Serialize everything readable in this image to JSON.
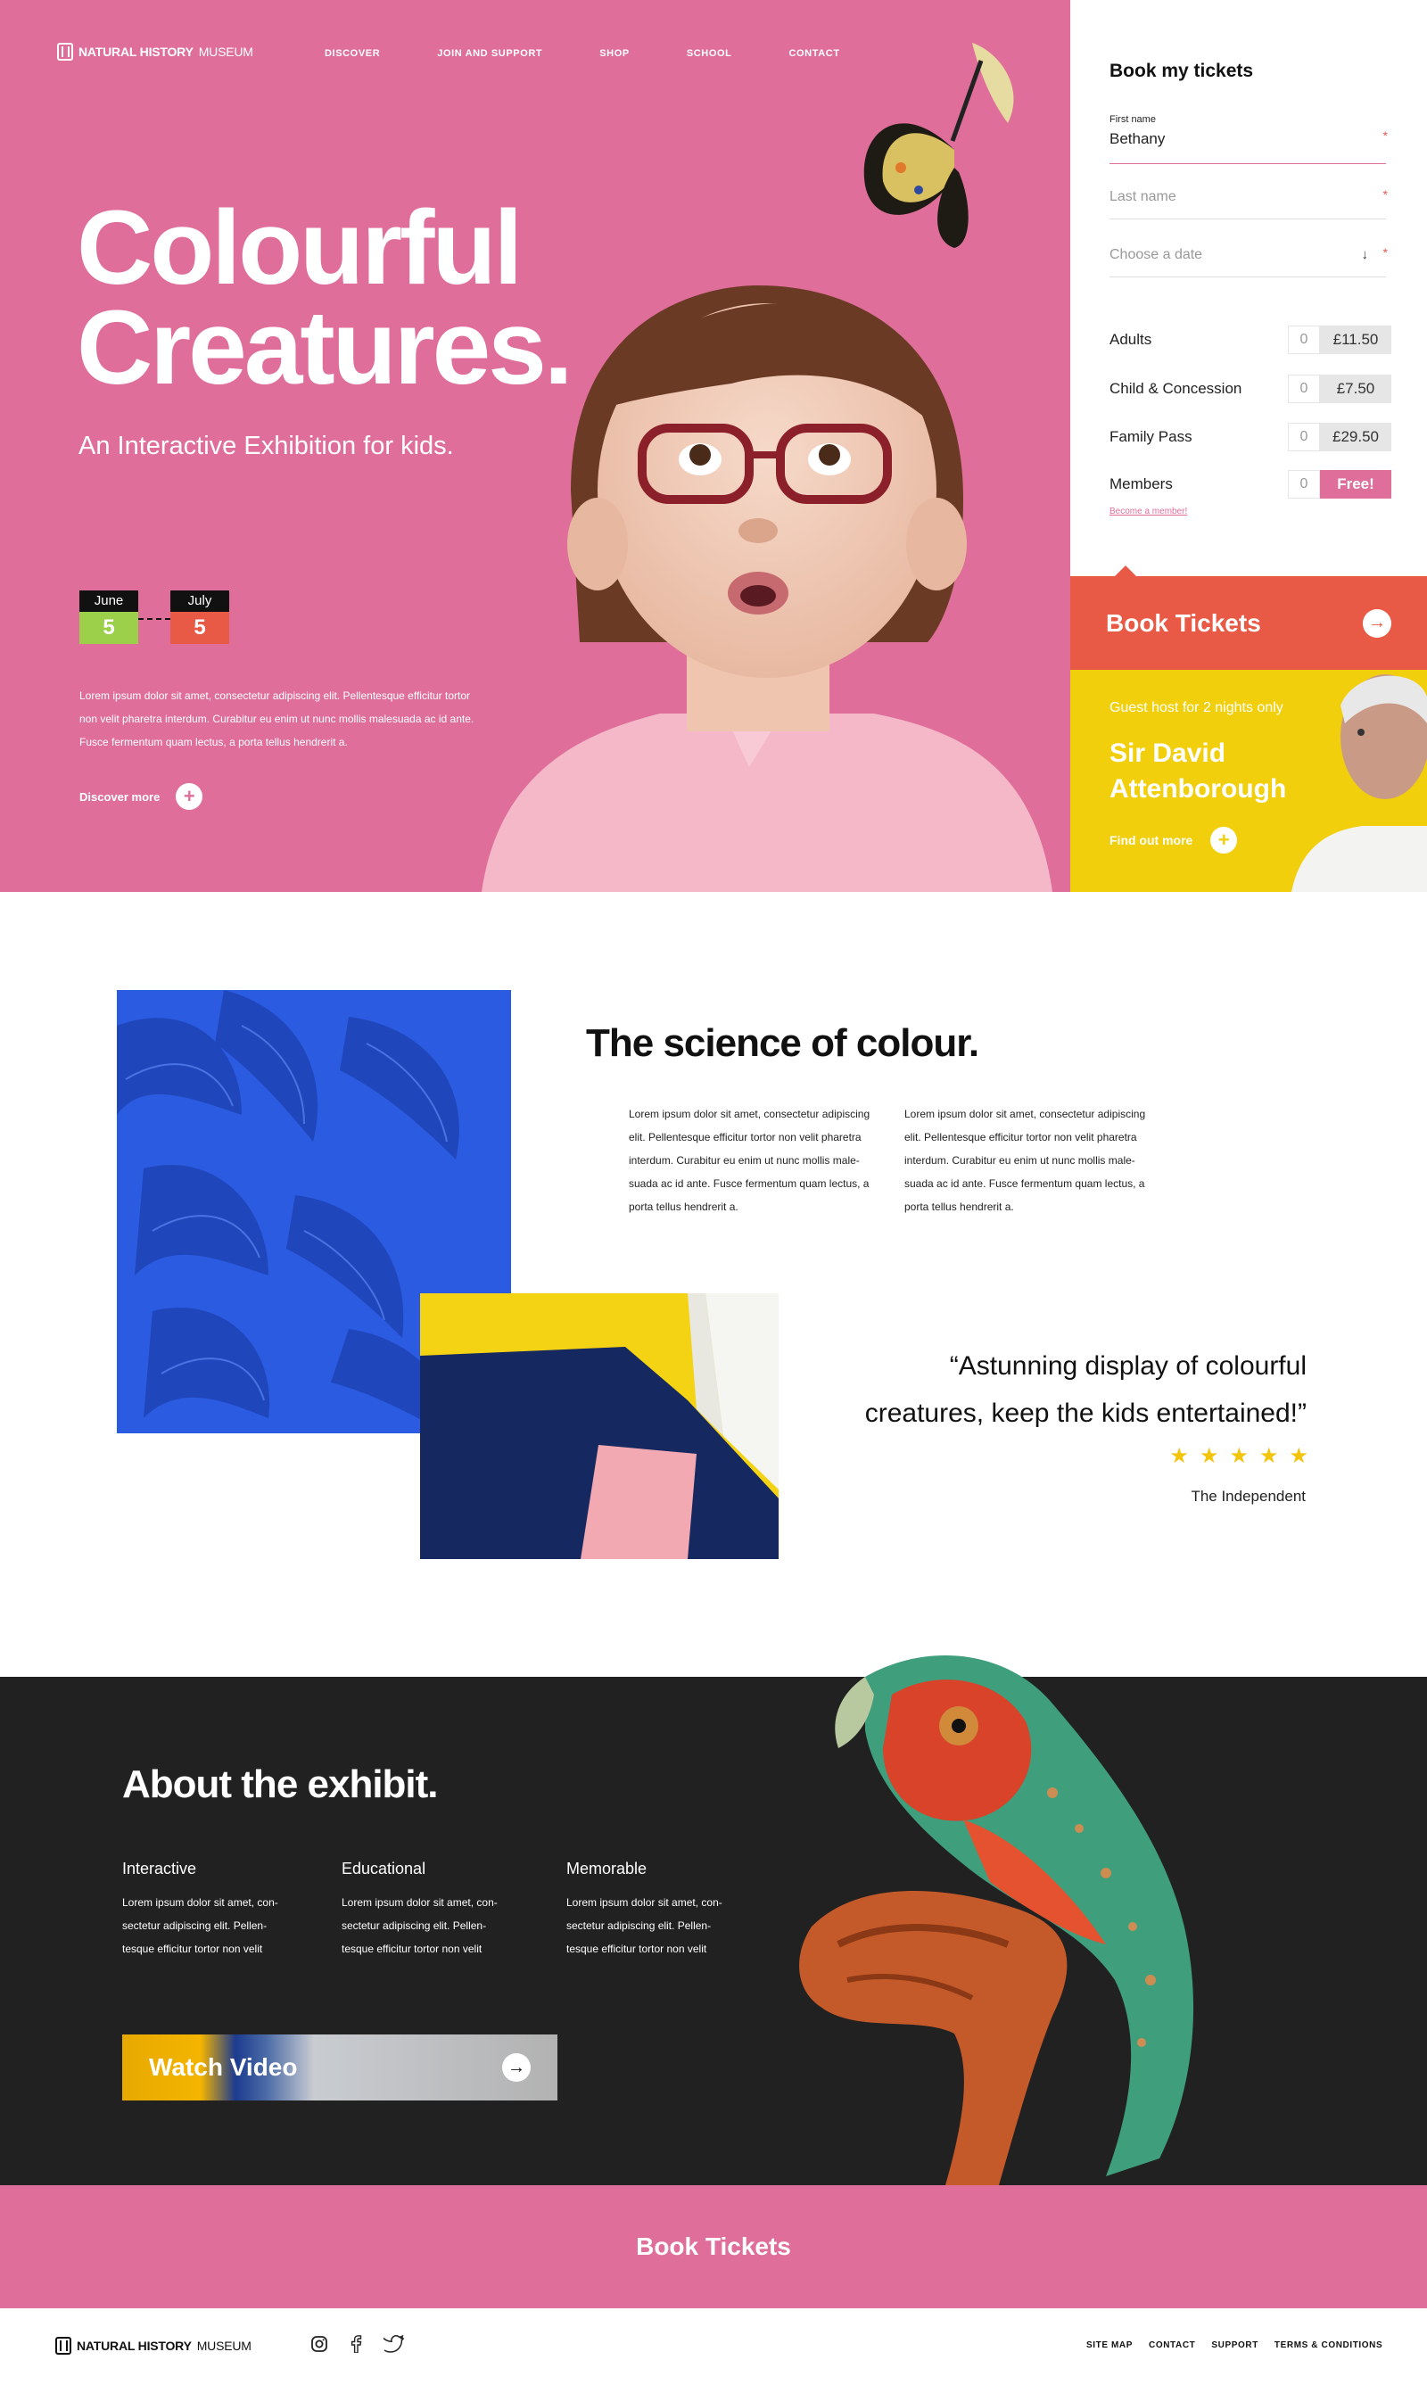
{
  "colors": {
    "pink": "#df6f9a",
    "coral": "#e85a45",
    "yellow": "#f2cf0c",
    "dark": "#222122",
    "green": "#9ccf4a"
  },
  "brand": {
    "logo_bold": "NATURAL HISTORY",
    "logo_light": "MUSEUM"
  },
  "nav": [
    "DISCOVER",
    "JOIN AND SUPPORT",
    "SHOP",
    "SCHOOL",
    "CONTACT"
  ],
  "hero": {
    "title_line1": "Colourful",
    "title_line2": "Creatures.",
    "subtitle": "An Interactive Exhibition for kids.",
    "date_start": {
      "month": "June",
      "day": "5"
    },
    "date_end": {
      "month": "July",
      "day": "5"
    },
    "body": "Lorem ipsum dolor sit amet, consectetur adipiscing elit. Pellentesque efficitur tortor non velit pharetra interdum. Curabitur eu enim ut nunc mollis malesuada ac id ante. Fusce fermentum quam lectus, a porta tellus hendrerit a.",
    "discover_label": "Discover more"
  },
  "booking": {
    "title": "Book my tickets",
    "first_name_label": "First name",
    "first_name_value": "Bethany",
    "last_name_placeholder": "Last name",
    "date_placeholder": "Choose a date",
    "tickets": [
      {
        "name": "Adults",
        "qty": "0",
        "price": "£11.50"
      },
      {
        "name": "Child & Concession",
        "qty": "0",
        "price": "£7.50"
      },
      {
        "name": "Family Pass",
        "qty": "0",
        "price": "£29.50"
      },
      {
        "name": "Members",
        "qty": "0",
        "price": "Free!"
      }
    ],
    "become_member": "Become a member!",
    "book_button": "Book Tickets"
  },
  "guest": {
    "kicker": "Guest host for 2 nights only",
    "name_line1": "Sir David",
    "name_line2": "Attenborough",
    "find_label": "Find out more"
  },
  "science": {
    "title": "The science of colour.",
    "col1": "Lorem ipsum dolor sit amet, consectetur adipiscing elit. Pellentesque efficitur tortor non velit pharetra interdum. Curabitur eu enim ut nunc mollis male-suada ac id ante. Fusce fermentum quam lectus, a porta tellus hendrerit a.",
    "col2": "Lorem ipsum dolor sit amet, consectetur adipiscing elit. Pellentesque efficitur tortor non velit pharetra interdum. Curabitur eu enim ut nunc mollis male-suada ac id ante. Fusce fermentum quam lectus, a porta tellus hendrerit a.",
    "quote": "“Astunning display of colourful creatures, keep the kids entertained!”",
    "rating": 5,
    "source": "The Independent"
  },
  "about": {
    "title": "About the exhibit.",
    "columns": [
      {
        "heading": "Interactive",
        "text": "Lorem ipsum dolor sit amet, con-sectetur adipiscing elit. Pellen-tesque efficitur tortor non velit"
      },
      {
        "heading": "Educational",
        "text": "Lorem ipsum dolor sit amet, con-sectetur adipiscing elit. Pellen-tesque efficitur tortor non velit"
      },
      {
        "heading": "Memorable",
        "text": "Lorem ipsum dolor sit amet, con-sectetur adipiscing elit. Pellen-tesque efficitur tortor non velit"
      }
    ],
    "watch_label": "Watch Video"
  },
  "cta": {
    "label": "Book Tickets"
  },
  "footer": {
    "social_icons": [
      "instagram-icon",
      "facebook-icon",
      "twitter-icon"
    ],
    "links": [
      "SITE MAP",
      "CONTACT",
      "SUPPORT",
      "TERMS & CONDITIONS"
    ]
  }
}
